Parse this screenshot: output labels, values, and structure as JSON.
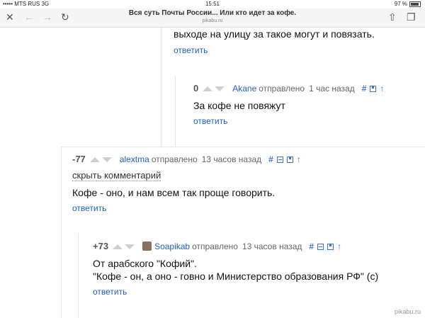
{
  "status_bar": {
    "carrier": "••••• MTS RUS  3G",
    "time": "15:51",
    "battery": "97 %"
  },
  "browser": {
    "title": "Вся суть Почты России... Или кто идет за кофе.",
    "domain": "pikabu.ru",
    "close_icon": "x-icon",
    "back_icon": "arrow-left-icon",
    "forward_icon": "arrow-right-icon",
    "reload_icon": "reload-icon",
    "share_icon": "share-icon",
    "tabs_icon": "tabs-icon"
  },
  "comments": {
    "top": {
      "text": "выходе на улицу за такое могут и повязать.",
      "reply": "ответить"
    },
    "akane": {
      "rating": "0",
      "author": "Akane",
      "sent": "отправлено",
      "ago": "1 час назад",
      "text": "За кофе не повяжут",
      "reply": "ответить"
    },
    "alextma": {
      "rating": "-77",
      "author": "alextma",
      "sent": "отправлено",
      "ago": "13 часов назад",
      "hide": "скрыть комментарий",
      "text": "Кофе - оно, и нам всем так проще говорить.",
      "reply": "ответить"
    },
    "soapikab": {
      "rating": "+73",
      "author": "Soapikab",
      "sent": "отправлено",
      "ago": "13 часов назад",
      "text_line1": "От арабского \"Кофий\".",
      "text_line2": "\"Кофе - он, а оно - говно и Министерство образования РФ\" (с)",
      "reply": "ответить"
    }
  },
  "watermark": "pikabu.ru"
}
